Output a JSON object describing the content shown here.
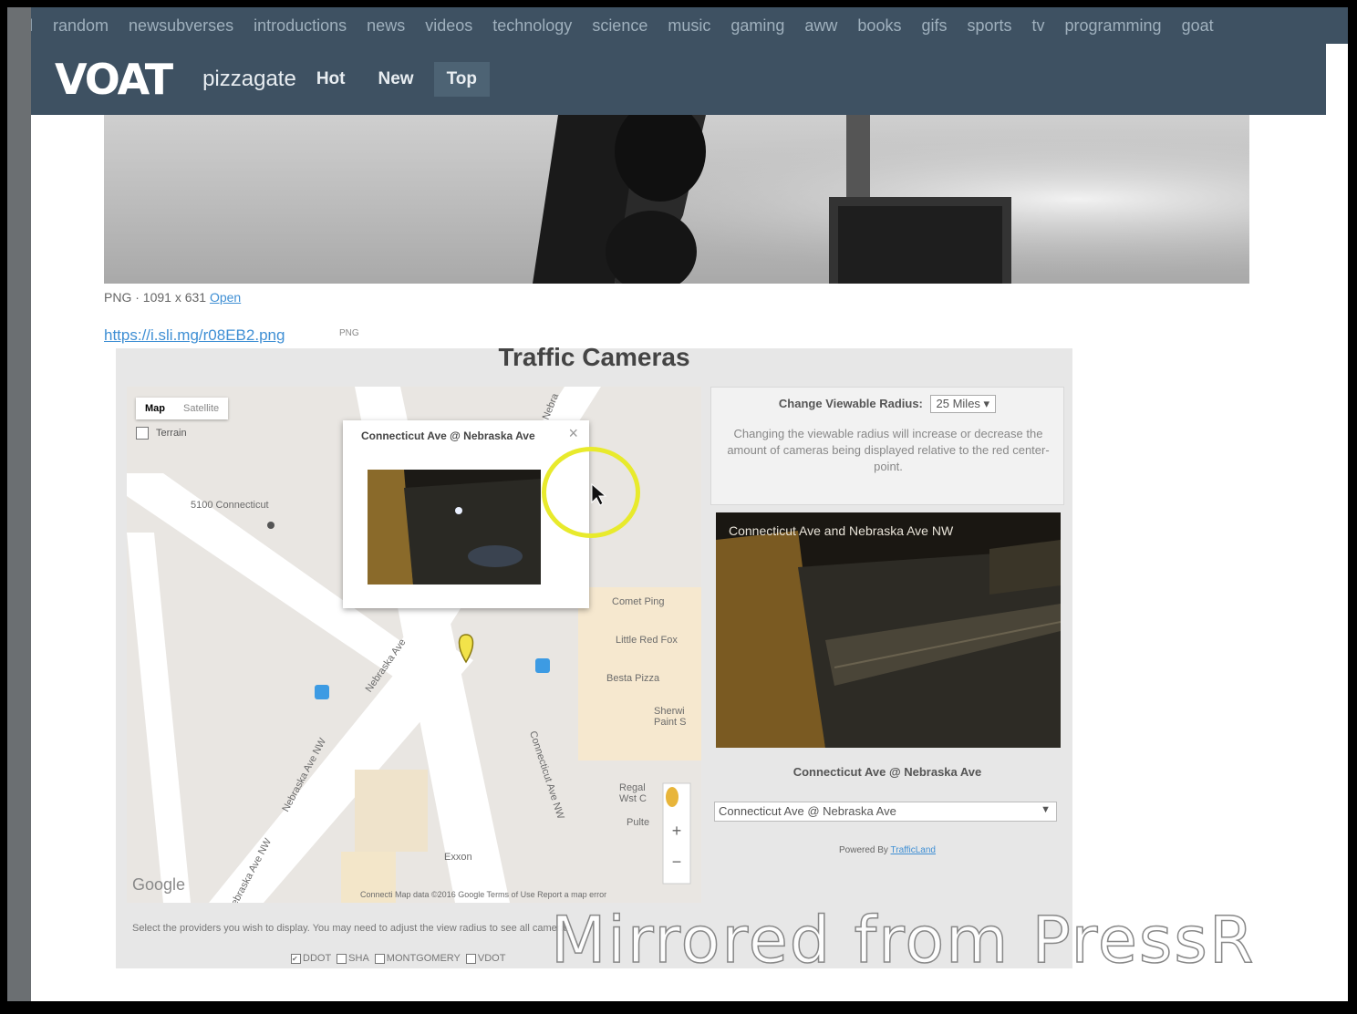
{
  "topnav": [
    "all",
    "random",
    "newsubverses",
    "introductions",
    "news",
    "videos",
    "technology",
    "science",
    "music",
    "gaming",
    "aww",
    "books",
    "gifs",
    "sports",
    "tv",
    "programming",
    "goat"
  ],
  "header": {
    "logo": "VOAT",
    "subverse": "pizzagate",
    "tabs": [
      {
        "label": "Hot",
        "active": false
      },
      {
        "label": "New",
        "active": false
      },
      {
        "label": "Top",
        "active": true
      }
    ]
  },
  "image_info": {
    "text": "PNG · 1091 x 631 ",
    "open_link": "Open"
  },
  "image_url": {
    "text": "https://i.sli.mg/r08EB2.png",
    "tag": "PNG"
  },
  "traffic_cameras": {
    "title": "Traffic Cameras",
    "map": {
      "type_tabs": [
        "Map",
        "Satellite"
      ],
      "terrain_label": "Terrain",
      "popup_title": "Connecticut Ave @ Nebraska Ave",
      "labels": {
        "5100": "5100 Connecticut",
        "comet": "Comet Ping",
        "redfox": "Little Red Fox",
        "besta": "Besta Pizza",
        "sherwin": "Sherwi Paint S",
        "regal": "Regal Wst C",
        "pulte": "Pulte",
        "exxon": "Exxon",
        "neb1": "Nebraska Ave",
        "neb2": "Nebraska Ave NW",
        "neb3": "Nebraska Ave NW",
        "conn": "Connecticut Ave NW",
        "nebr_top": "Nebra",
        "google": "Google",
        "footer": "Connecti Map data ©2016 Google   Terms of Use   Report a map error"
      }
    },
    "radius": {
      "label": "Change Viewable Radius:",
      "value": "25 Miles"
    },
    "radius_desc": "Changing the viewable radius will increase or decrease the amount of cameras being displayed relative to the red center-point.",
    "camera_overlay": "Connecticut Ave and Nebraska Ave NW",
    "camera_caption": "Connecticut Ave @ Nebraska Ave",
    "camera_select": "Connecticut Ave @ Nebraska Ave",
    "powered_by": "Powered By ",
    "powered_link": "TrafficLand",
    "providers_text": "Select the providers you wish to display. You may need to adjust the view radius to see all cameras.",
    "providers": [
      "DDOT",
      "SHA",
      "MONTGOMERY",
      "VDOT"
    ]
  },
  "watermark": "Mirrored from PressR"
}
